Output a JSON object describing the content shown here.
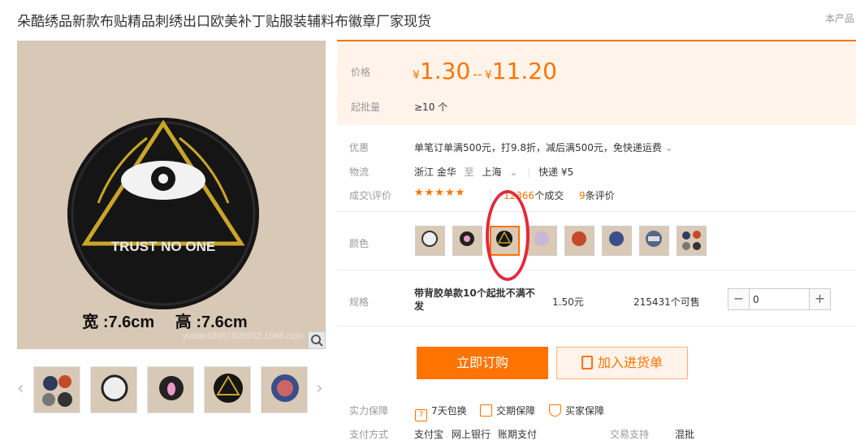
{
  "product": {
    "title": "朵酷绣品新款布贴精品刺绣出口欧美补丁贴服装辅料布徽章厂家现货",
    "top_right_text": "本产品"
  },
  "image": {
    "patch_text": "TRUST NO ONE",
    "size_text": "宽 :7.6cm　 高 :7.6cm",
    "watermark": "yudan18957929202.1688.com"
  },
  "price": {
    "label": "价格",
    "currency": "¥",
    "min": "1.30",
    "sep": "--",
    "max": "11.20",
    "moq_label": "起批量",
    "moq_value": "≥10 个"
  },
  "promo": {
    "label": "优惠",
    "text": "单笔订单满500元，打9.8折，减后满500元，免快递运费"
  },
  "logistics": {
    "label": "物流",
    "from": "浙江 金华",
    "to_word": "至",
    "to": "上海",
    "shipping": "快递 ¥5"
  },
  "deals": {
    "label": "成交\\评价",
    "stars": "★★★★★",
    "count": "12366",
    "count_suffix": "个成交",
    "reviews": "9",
    "reviews_suffix": "条评价"
  },
  "color": {
    "label": "颜色",
    "selected_index": 2
  },
  "spec": {
    "label": "规格",
    "name_line1": "带背胶单款10个起批不满不",
    "name_line2": "发",
    "price": "1.50元",
    "stock": "215431个可售",
    "quantity": "0",
    "minus": "−",
    "plus": "+"
  },
  "buttons": {
    "buy": "立即订购",
    "cart": "加入进货单"
  },
  "service": {
    "label": "实力保障",
    "items": [
      "7天包换",
      "交期保障",
      "买家保障"
    ]
  },
  "payment": {
    "label": "支付方式",
    "methods": [
      "支付宝",
      "网上银行",
      "账期支付"
    ],
    "trade_label": "交易支持",
    "trade_value": "混批"
  },
  "colors": {
    "accent": "#ff7300",
    "price_bg": "#fff3ea",
    "annotation": "#e32a3c"
  }
}
